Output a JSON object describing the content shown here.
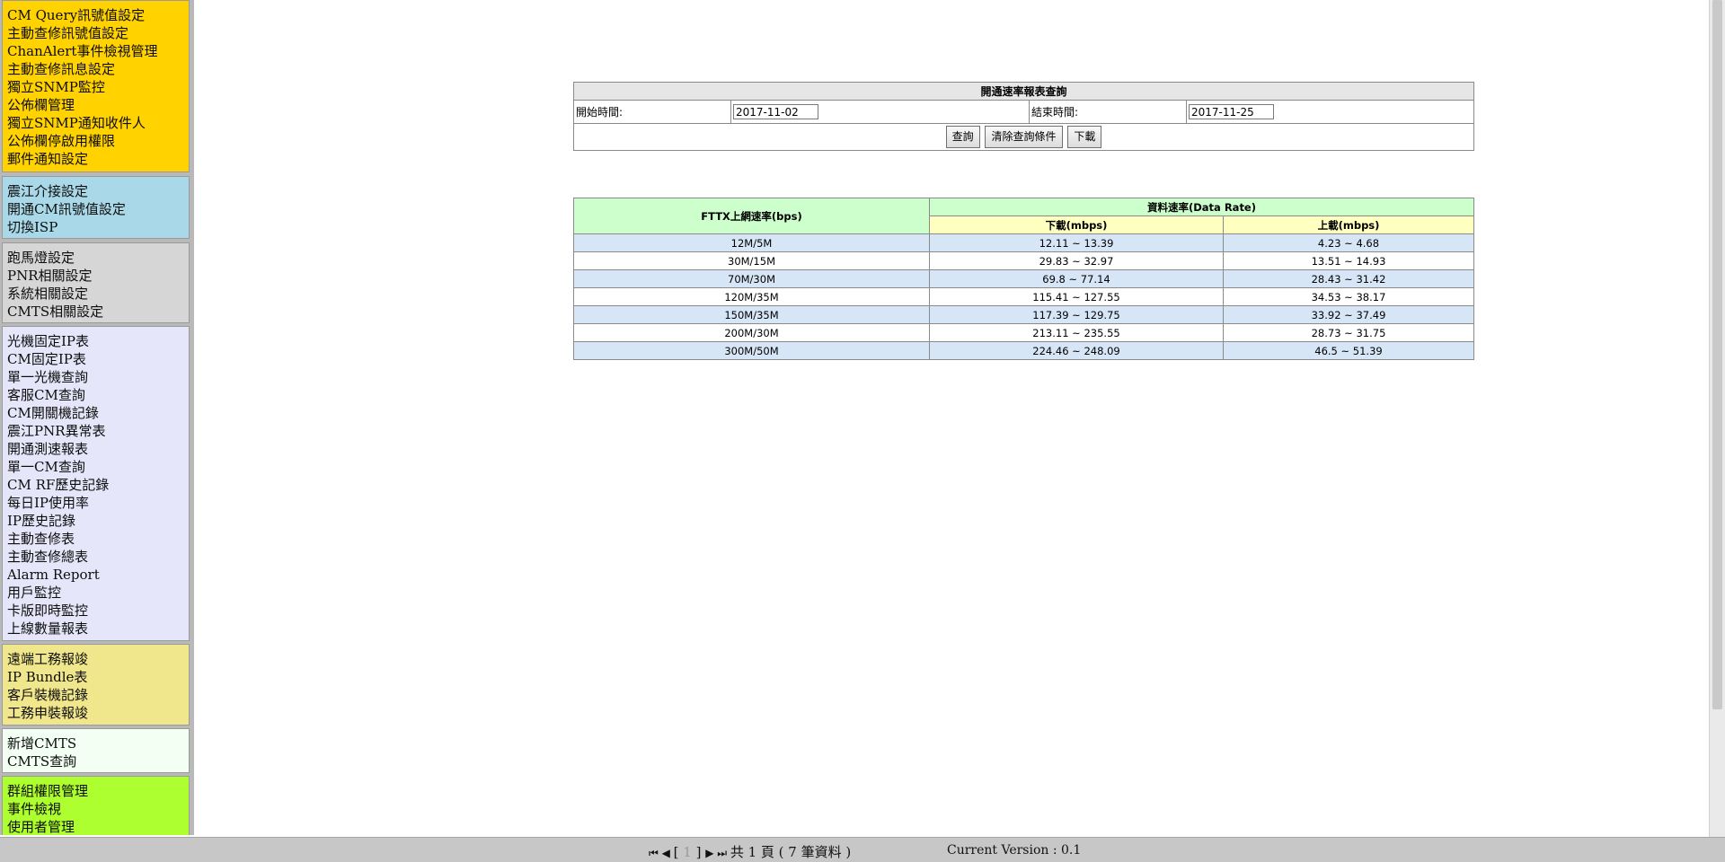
{
  "sidebar": {
    "group1": [
      "CM Query訊號值設定",
      "主動查修訊號值設定",
      "ChanAlert事件檢視管理",
      "主動查修訊息設定",
      "獨立SNMP監控",
      "公佈欄管理",
      "獨立SNMP通知收件人",
      "公佈欄停啟用權限",
      "郵件通知設定"
    ],
    "group2": [
      "震江介接設定",
      "開通CM訊號值設定",
      "切換ISP"
    ],
    "group3": [
      "跑馬燈設定",
      "PNR相關設定",
      "系統相關設定",
      "CMTS相關設定"
    ],
    "group4": [
      "光機固定IP表",
      "CM固定IP表",
      "單一光機查詢",
      "客服CM查詢",
      "CM開關機記錄",
      "震江PNR異常表",
      "開通測速報表",
      "單一CM查詢",
      "CM RF歷史記錄",
      "每日IP使用率",
      "IP歷史記錄",
      "主動查修表",
      "主動查修總表",
      "Alarm Report",
      "用戶監控",
      "卡版即時監控",
      "上線數量報表"
    ],
    "group5": [
      "遠端工務報竣",
      "IP Bundle表",
      "客戶裝機記錄",
      "工務申裝報竣"
    ],
    "group6": [
      "新增CMTS",
      "CMTS查詢"
    ],
    "group7": [
      "群組權限管理",
      "事件檢視",
      "使用者管理"
    ]
  },
  "query": {
    "title": "開通速率報表查詢",
    "start_label": "開始時間:",
    "start_value": "2017-11-02",
    "end_label": "結束時間:",
    "end_value": "2017-11-25",
    "buttons": {
      "query": "查詢",
      "clear": "清除查詢條件",
      "download": "下載"
    }
  },
  "rate_table": {
    "header_left": "FTTX上網速率(bps)",
    "header_group": "資料速率(Data Rate)",
    "header_down": "下載(mbps)",
    "header_up": "上載(mbps)",
    "rows": [
      [
        "12M/5M",
        "12.11 ~ 13.39",
        "4.23 ~ 4.68"
      ],
      [
        "30M/15M",
        "29.83 ~ 32.97",
        "13.51 ~ 14.93"
      ],
      [
        "70M/30M",
        "69.8 ~ 77.14",
        "28.43 ~ 31.42"
      ],
      [
        "120M/35M",
        "115.41 ~ 127.55",
        "34.53 ~ 38.17"
      ],
      [
        "150M/35M",
        "117.39 ~ 129.75",
        "33.92 ~ 37.49"
      ],
      [
        "200M/30M",
        "213.11 ~ 235.55",
        "28.73 ~ 31.75"
      ],
      [
        "300M/50M",
        "224.46 ~ 248.09",
        "46.5 ~ 51.39"
      ]
    ]
  },
  "status": {
    "page_open": "[",
    "page_current": "1",
    "page_close": "]",
    "page_total": "共 1 頁 ( 7 筆資料 )",
    "version": "Current Version : 0.1"
  }
}
